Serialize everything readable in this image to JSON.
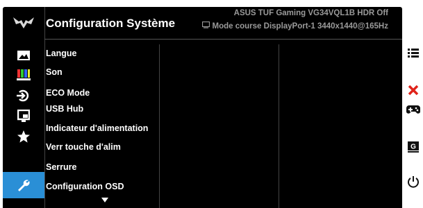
{
  "header": {
    "title": "Configuration Système",
    "model": "ASUS TUF Gaming VG34VQL1B  HDR Off",
    "mode": "Mode course DisplayPort-1 3440x1440@165Hz"
  },
  "sidebar": {
    "items": [
      {
        "icon": "image-icon",
        "label": "Image"
      },
      {
        "icon": "color-icon",
        "label": "Couleur"
      },
      {
        "icon": "input-select-icon",
        "label": "Sélection entrée"
      },
      {
        "icon": "pip-icon",
        "label": "PIP/PBP"
      },
      {
        "icon": "favorite-star-icon",
        "label": "MyFavorite"
      },
      {
        "icon": "wrench-icon",
        "label": "Configuration Système",
        "active": true
      }
    ]
  },
  "menu": {
    "items": [
      "Langue",
      "Son",
      "ECO Mode",
      "USB Hub",
      "Indicateur d'alimentation",
      "Verr touche d'alim",
      "Serrure",
      "Configuration OSD"
    ]
  },
  "right_buttons": [
    "menu-icon",
    "close-icon",
    "gamepad-icon",
    "gameplus-icon",
    "power-icon"
  ],
  "colors": {
    "accent": "#2a8fd6",
    "close": "#e0231a",
    "panel": "#000000"
  }
}
